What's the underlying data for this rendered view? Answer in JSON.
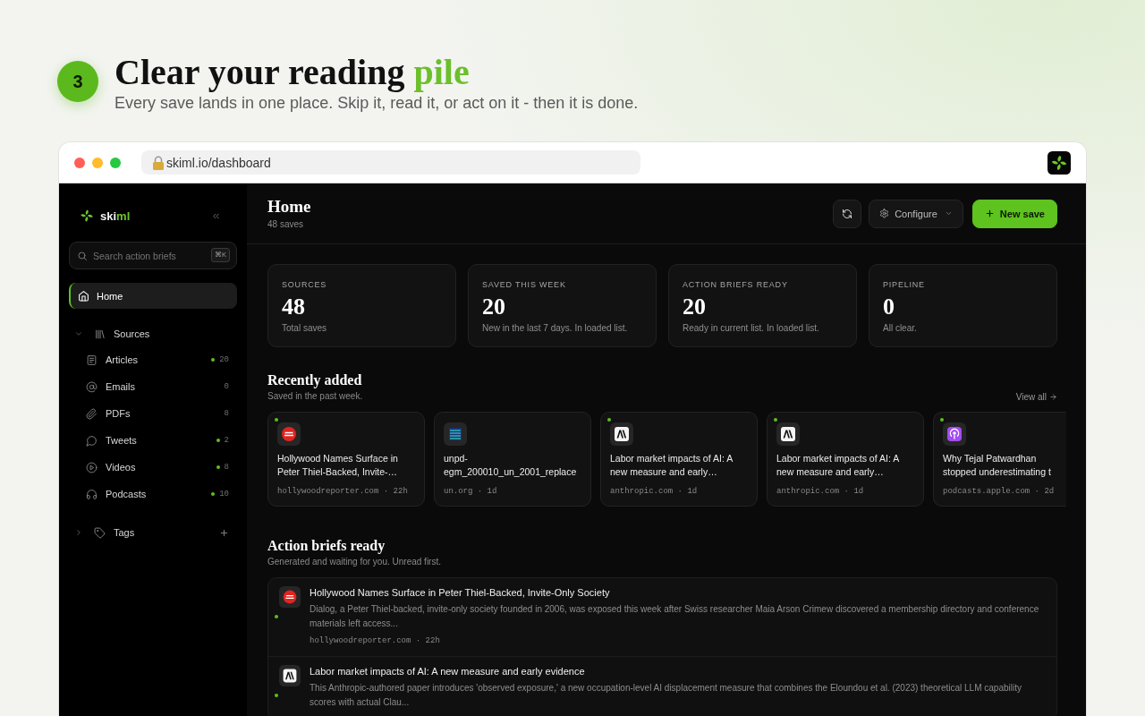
{
  "intro": {
    "step": "3",
    "title": "Clear your reading",
    "title_accent": "pile",
    "subtitle": "Every save lands in one place. Skip it, read it, or act on it - then it is done."
  },
  "browser": {
    "url": "skiml.io/dashboard"
  },
  "sidebar": {
    "brand": {
      "name": "ski",
      "accent": "ml"
    },
    "search": {
      "placeholder": "Search action briefs",
      "shortcut": "⌘K"
    },
    "home": {
      "label": "Home",
      "selected": true
    },
    "groups": [
      {
        "label": "Sources",
        "expanded": true,
        "children": [
          {
            "label": "Articles",
            "count": "20",
            "new": true
          },
          {
            "label": "Emails",
            "count": "0",
            "new": false
          },
          {
            "label": "PDFs",
            "count": "8",
            "new": false
          },
          {
            "label": "Tweets",
            "count": "2",
            "new": true
          },
          {
            "label": "Videos",
            "count": "8",
            "new": true
          },
          {
            "label": "Podcasts",
            "count": "10",
            "new": true
          }
        ]
      },
      {
        "label": "Tags",
        "expanded": false
      }
    ]
  },
  "header": {
    "title": "Home",
    "subtitle": "48 saves",
    "buttons": [
      {
        "kind": "refresh"
      },
      {
        "kind": "menu",
        "label": "Configure"
      },
      {
        "kind": "primary",
        "label": "New save"
      }
    ]
  },
  "stats": [
    {
      "label": "SOURCES",
      "value": "48",
      "caption": "Total saves"
    },
    {
      "label": "SAVED THIS WEEK",
      "value": "20",
      "caption": "New in the last 7 days. In loaded list."
    },
    {
      "label": "ACTION BRIEFS READY",
      "value": "20",
      "caption": "Ready in current list. In loaded list."
    },
    {
      "label": "PIPELINE",
      "value": "0",
      "caption": "All clear."
    }
  ],
  "recent": {
    "title": "Recently added",
    "subtitle": "Saved in the past week.",
    "link": "View all",
    "cards": [
      {
        "kind": "disc",
        "unread": true,
        "title": "Hollywood Names Surface in Peter Thiel-Backed, Invite-…",
        "meta": "hollywoodreporter.com · 22h"
      },
      {
        "kind": "bars",
        "unread": false,
        "title": "unpd-egm_200010_un_2001_replace",
        "meta": "un.org · 1d"
      },
      {
        "kind": "peak",
        "unread": true,
        "title": "Labor market impacts of AI: A new measure and early…",
        "meta": "anthropic.com · 1d"
      },
      {
        "kind": "peak",
        "unread": true,
        "title": "Labor market impacts of AI: A new measure and early…",
        "meta": "anthropic.com · 1d"
      },
      {
        "kind": "podcast",
        "unread": true,
        "title": "Why Tejal Patwardhan stopped underestimating t",
        "meta": "podcasts.apple.com · 2d"
      }
    ]
  },
  "briefs": {
    "title": "Action briefs ready",
    "subtitle": "Generated and waiting for you. Unread first.",
    "items": [
      {
        "kind": "disc",
        "unread": true,
        "title": "Hollywood Names Surface in Peter Thiel-Backed, Invite-Only Society",
        "summary": "Dialog, a Peter Thiel-backed, invite-only society founded in 2006, was exposed this week after Swiss researcher Maia Arson Crimew discovered a membership directory and conference materials left access...",
        "meta": "hollywoodreporter.com · 22h"
      },
      {
        "kind": "peak",
        "unread": true,
        "title": "Labor market impacts of AI: A new measure and early evidence",
        "summary": "This Anthropic-authored paper introduces 'observed exposure,' a new occupation-level AI displacement measure that combines the Eloundou et al. (2023) theoretical LLM capability scores with actual Clau..."
      }
    ]
  }
}
